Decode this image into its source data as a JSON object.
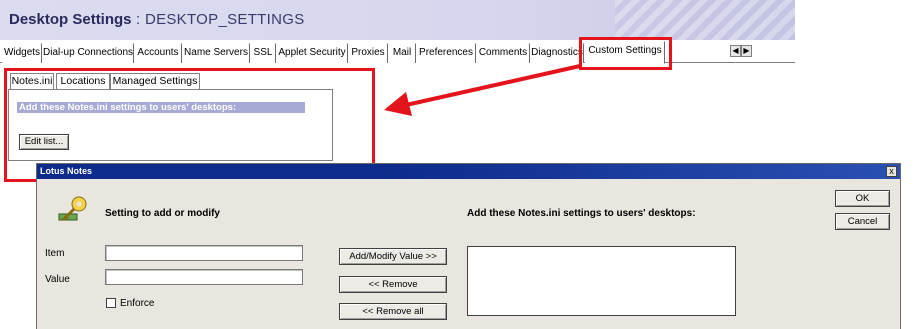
{
  "header": {
    "title": "Desktop Settings",
    "separator": " : ",
    "subtitle": "DESKTOP_SETTINGS"
  },
  "tabs": [
    {
      "label": "Widgets"
    },
    {
      "label": "Dial-up Connections"
    },
    {
      "label": "Accounts"
    },
    {
      "label": "Name Servers"
    },
    {
      "label": "SSL"
    },
    {
      "label": "Applet Security"
    },
    {
      "label": "Proxies"
    },
    {
      "label": "Mail"
    },
    {
      "label": "Preferences"
    },
    {
      "label": "Comments"
    },
    {
      "label": "Diagnostics"
    },
    {
      "label": "Custom Settings"
    }
  ],
  "scroll": {
    "left": "◀",
    "right": "▶"
  },
  "inner_tabs": [
    {
      "label": "Notes.ini"
    },
    {
      "label": "Locations"
    },
    {
      "label": "Managed Settings"
    }
  ],
  "panel": {
    "bar_text": "Add these Notes.ini settings to users' desktops:",
    "edit_button": "Edit list..."
  },
  "dialog": {
    "title": "Lotus Notes",
    "close": "x",
    "setting_heading": "Setting to add or modify",
    "list_heading": "Add these Notes.ini settings to users' desktops:",
    "item_label": "Item",
    "value_label": "Value",
    "enforce_label": "Enforce",
    "add_modify_button": "Add/Modify Value >>",
    "remove_button": "<< Remove",
    "remove_all_button": "<< Remove all",
    "ok_button": "OK",
    "cancel_button": "Cancel",
    "item_value": "",
    "value_value": ""
  },
  "colors": {
    "highlight": "#e3141b",
    "title_bar": "#0c2b8a",
    "panel_bar": "#a8aad6",
    "header_text": "#2a2a5e"
  }
}
